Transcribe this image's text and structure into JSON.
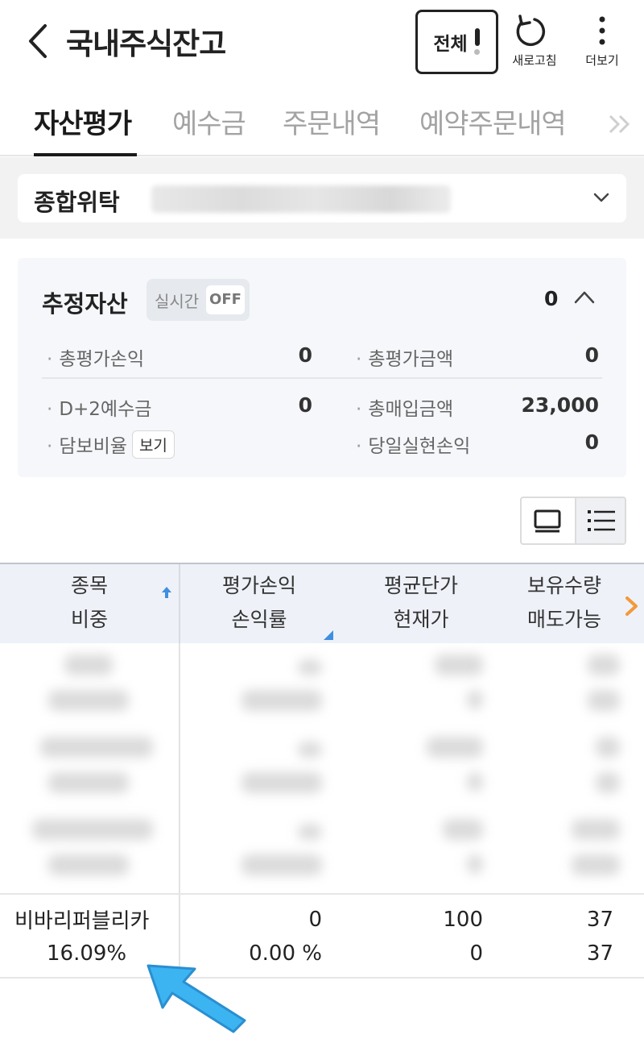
{
  "header": {
    "title": "국내주식잔고",
    "all_button": "전체",
    "refresh_label": "새로고침",
    "more_label": "더보기"
  },
  "tabs": [
    {
      "label": "자산평가",
      "active": true
    },
    {
      "label": "예수금",
      "active": false
    },
    {
      "label": "주문내역",
      "active": false
    },
    {
      "label": "예약주문내역",
      "active": false
    }
  ],
  "account": {
    "type_label": "종합위탁"
  },
  "summary": {
    "title": "추정자산",
    "realtime_label": "실시간",
    "realtime_state": "OFF",
    "total_value": "0",
    "items": {
      "total_eval_pl_label": "총평가손익",
      "total_eval_pl_value": "0",
      "total_eval_amount_label": "총평가금액",
      "total_eval_amount_value": "0",
      "d2_deposit_label": "D+2예수금",
      "d2_deposit_value": "0",
      "total_purchase_label": "총매입금액",
      "total_purchase_value": "23,000",
      "collateral_ratio_label": "담보비율",
      "collateral_view_button": "보기",
      "realized_pl_label": "당일실현손익",
      "realized_pl_value": "0"
    }
  },
  "table": {
    "headers": {
      "col1_line1": "종목",
      "col1_line2": "비중",
      "col2_line1": "평가손익",
      "col2_line2": "손익률",
      "col3_line1": "평균단가",
      "col3_line2": "현재가",
      "col4_line1": "보유수량",
      "col4_line2": "매도가능"
    },
    "visible_row": {
      "name": "비바리퍼블리카",
      "weight": "16.09%",
      "eval_pl": "0",
      "pl_rate": "0.00 %",
      "avg_price": "100",
      "current_price": "0",
      "quantity": "37",
      "sellable": "37"
    }
  },
  "colors": {
    "accent_blue": "#3f8fe0",
    "scroll_arrow_orange": "#f29a3a",
    "arrow_annotation": "#39b3f0"
  }
}
